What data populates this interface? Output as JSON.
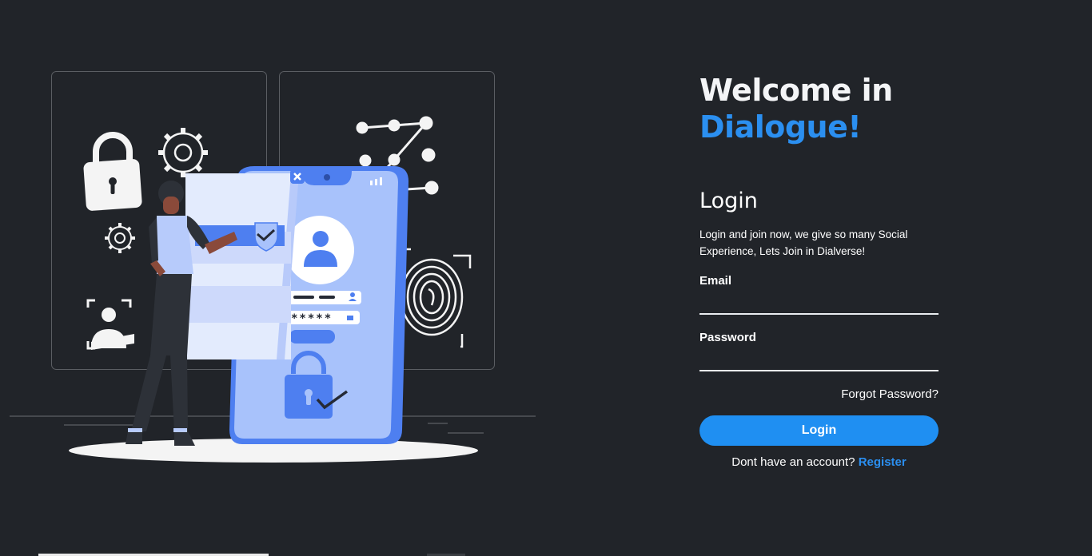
{
  "hero": {
    "welcome_line1": "Welcome in",
    "welcome_brand": "Dialogue!",
    "illustration_masked_password": "*****"
  },
  "login": {
    "heading": "Login",
    "subtitle": "Login and join now, we give so many Social Experience, Lets Join in Dialverse!",
    "email_label": "Email",
    "email_value": "",
    "password_label": "Password",
    "password_value": "",
    "forgot_password": "Forgot Password?",
    "submit_label": "Login",
    "no_account_text": "Dont have an account?",
    "register_link": "Register"
  },
  "colors": {
    "background": "#212429",
    "accent": "#1f8ff2",
    "phone_body": "#a8c2fb",
    "phone_frame": "#4e7ff0"
  }
}
